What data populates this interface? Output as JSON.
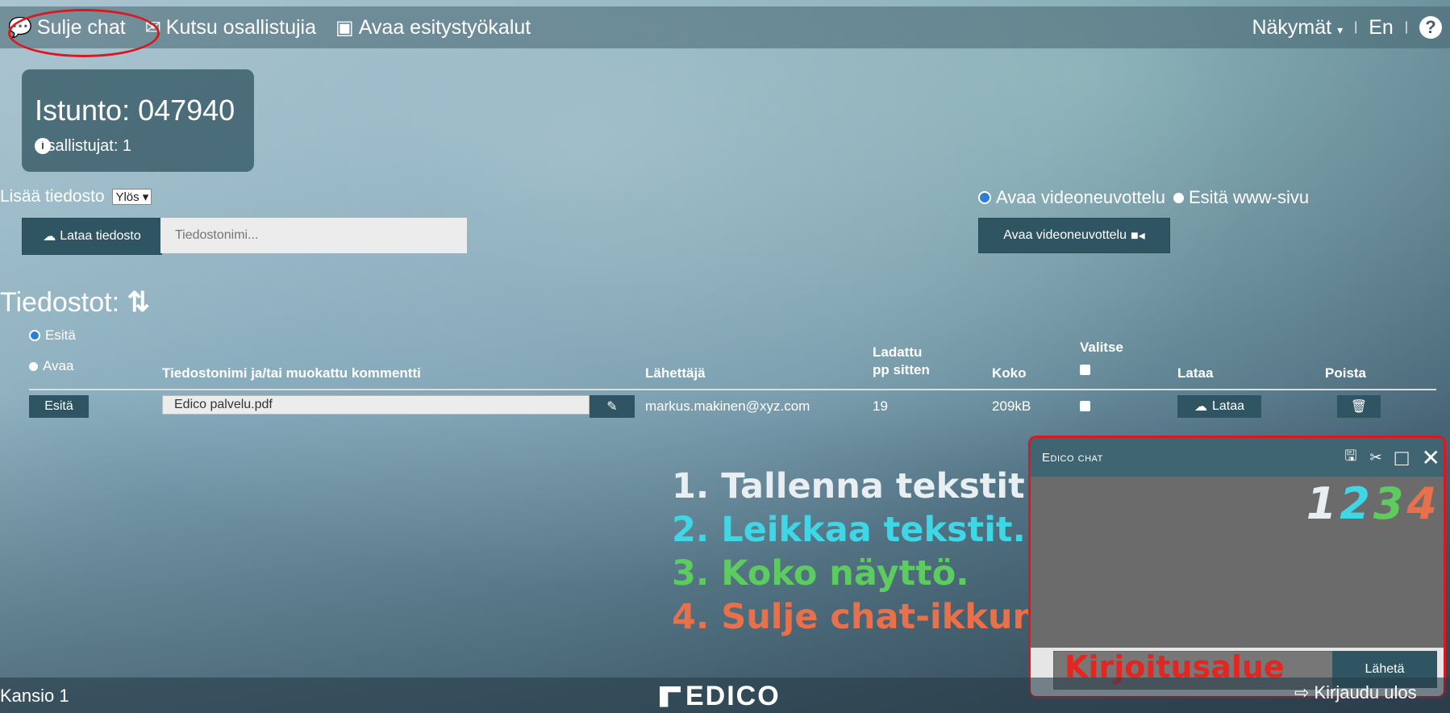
{
  "topbar": {
    "close_chat": "Sulje chat",
    "invite": "Kutsu osallistujia",
    "open_tools": "Avaa esitystyökalut",
    "views": "Näkymät",
    "lang": "En"
  },
  "session": {
    "title": "Istunto: 047940",
    "participants": "Osallistujat: 1"
  },
  "upload": {
    "add_label": "Lisää tiedosto",
    "position_select": "Ylös",
    "button": "Lataa tiedosto",
    "placeholder": "Tiedostonimi..."
  },
  "video": {
    "radio_open": "Avaa videoneuvottelu",
    "radio_show": "Esitä www-sivu",
    "button": "Avaa videoneuvottelu"
  },
  "files": {
    "title": "Tiedostot:",
    "radio_show": "Esitä",
    "radio_open": "Avaa",
    "headers": {
      "name": "Tiedostonimi ja/tai muokattu kommentti",
      "sender": "Lähettäjä",
      "uploaded_1": "Ladattu",
      "uploaded_2": "pp sitten",
      "size": "Koko",
      "select": "Valitse",
      "download": "Lataa",
      "delete": "Poista"
    },
    "rows": [
      {
        "action": "Esitä",
        "filename": "Edico palvelu.pdf",
        "sender": "markus.makinen@xyz.com",
        "days": "19",
        "size": "209kB",
        "download": "Lataa"
      }
    ]
  },
  "instructions": [
    {
      "text": "1. Tallenna tekstit.",
      "color": "#e8eef2"
    },
    {
      "text": "2. Leikkaa tekstit.",
      "color": "#3fd6e6"
    },
    {
      "text": "3. Koko näyttö.",
      "color": "#5ccc5e"
    },
    {
      "text": "4. Sulje chat-ikkuna.",
      "color": "#e8704a"
    }
  ],
  "chat": {
    "title": "Edico chat",
    "nums": [
      "1",
      "2",
      "3",
      "4"
    ],
    "num_colors": [
      "#e8eef2",
      "#3fd6e6",
      "#5ccc5e",
      "#e8704a"
    ],
    "input_label": "Kirjoitusalue",
    "send": "Lähetä"
  },
  "footer": {
    "folder": "Kansio 1",
    "logo": "EDICO",
    "logout": "Kirjaudu ulos"
  }
}
